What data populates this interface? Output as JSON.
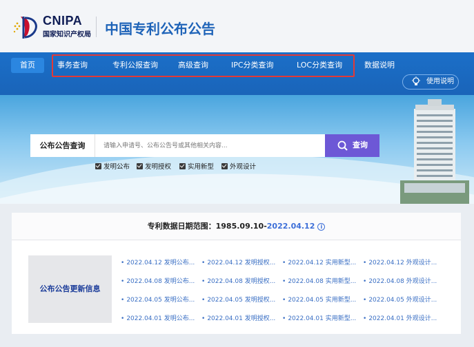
{
  "header": {
    "logo_text": "CNIPA",
    "logo_sub": "国家知识产权局",
    "title": "中国专利公布公告"
  },
  "nav": {
    "home": "首页",
    "items": [
      "事务查询",
      "专利公报查询",
      "高级查询",
      "IPC分类查询",
      "LOC分类查询",
      "数据说明"
    ],
    "help": "使用说明"
  },
  "search": {
    "label": "公布公告查询",
    "placeholder": "请输入申请号、公布公告号或其他相关内容...",
    "button": "查询",
    "checkboxes": [
      "发明公布",
      "发明授权",
      "实用新型",
      "外观设计"
    ]
  },
  "date_range": {
    "prefix": "专利数据日期范围：1985.09.10-",
    "end": "2022.04.12"
  },
  "updates": {
    "label": "公布公告更新信息",
    "rows": [
      [
        "2022.04.12 发明公布...",
        "2022.04.12 发明授权...",
        "2022.04.12 实用新型...",
        "2022.04.12 外观设计..."
      ],
      [
        "2022.04.08 发明公布...",
        "2022.04.08 发明授权...",
        "2022.04.08 实用新型...",
        "2022.04.08 外观设计..."
      ],
      [
        "2022.04.05 发明公布...",
        "2022.04.05 发明授权...",
        "2022.04.05 实用新型...",
        "2022.04.05 外观设计..."
      ],
      [
        "2022.04.01 发明公布...",
        "2022.04.01 发明授权...",
        "2022.04.01 实用新型...",
        "2022.04.01 外观设计..."
      ]
    ]
  },
  "colors": {
    "nav_bg": "#1b6fc8",
    "highlight_box": "#e53935",
    "search_button": "#6d58d6",
    "link": "#3a6fc4"
  }
}
